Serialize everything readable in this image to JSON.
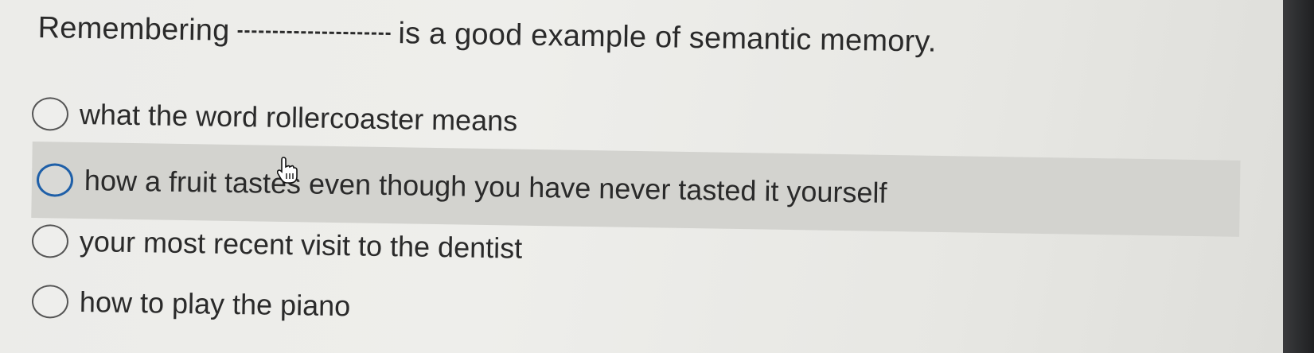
{
  "question": {
    "prefix": "Remembering",
    "suffix": "is a good example of semantic memory."
  },
  "options": [
    {
      "label": "what the word rollercoaster means",
      "selected": false,
      "hovered": false
    },
    {
      "label": "how a fruit tastes even though you have never tasted it yourself",
      "selected": false,
      "hovered": true
    },
    {
      "label": "your most recent visit to the dentist",
      "selected": false,
      "hovered": false
    },
    {
      "label": "how to play the piano",
      "selected": false,
      "hovered": false
    }
  ],
  "colors": {
    "hover_background": "#d3d3cf",
    "focus_ring": "#1e5fa8",
    "text": "#2a2a2a"
  },
  "icons": {
    "cursor": "hand-pointer-icon",
    "radio": "radio-circle-icon"
  }
}
